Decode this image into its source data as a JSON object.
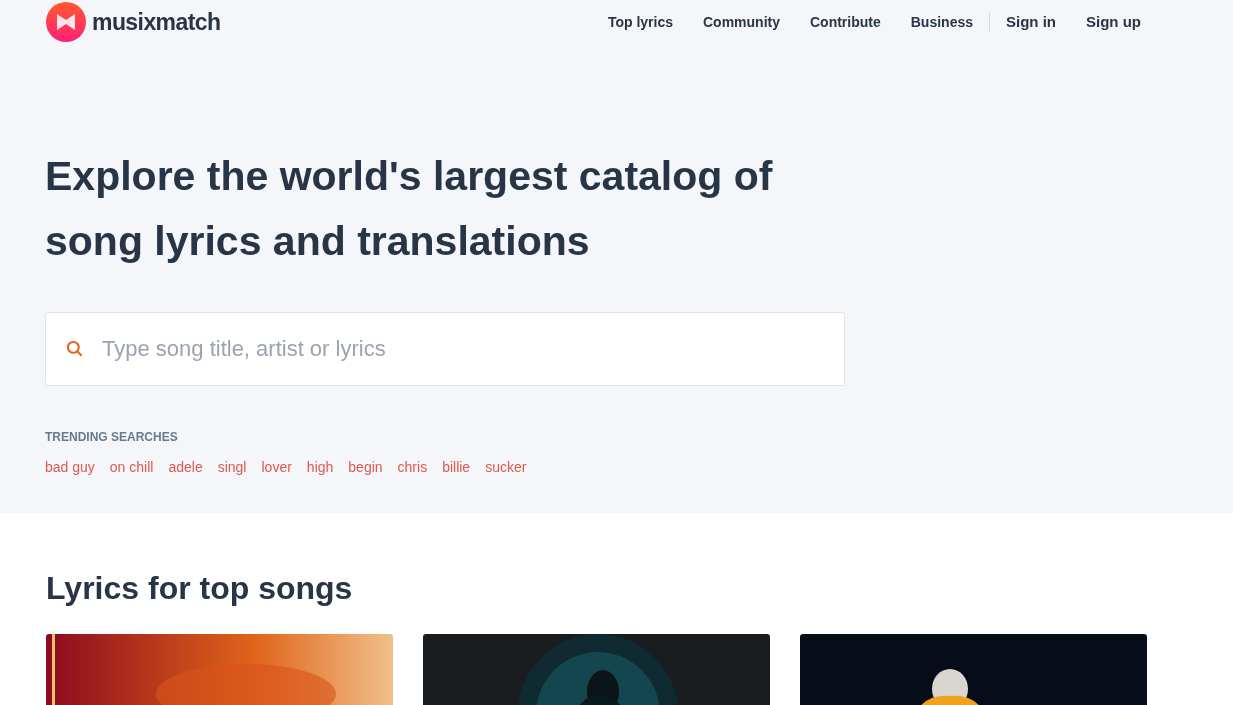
{
  "header": {
    "logo_text": "musixmatch",
    "nav": [
      "Top lyrics",
      "Community",
      "Contribute",
      "Business"
    ],
    "account": [
      "Sign in",
      "Sign up"
    ]
  },
  "hero": {
    "heading": "Explore the world's largest catalog of song lyrics and translations",
    "search": {
      "placeholder": "Type song title, artist or lyrics"
    },
    "trending_label": "TRENDING SEARCHES",
    "trending": [
      "bad guy",
      "on chill",
      "adele",
      "singl",
      "lover",
      "high",
      "begin",
      "chris",
      "billie",
      "sucker"
    ]
  },
  "top_songs": {
    "title": "Lyrics for top songs"
  }
}
